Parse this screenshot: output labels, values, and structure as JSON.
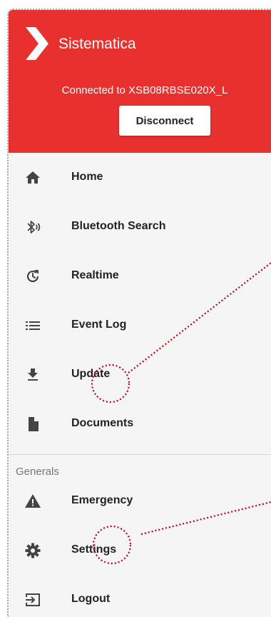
{
  "header": {
    "brand": "Sistematica",
    "connection_text": "Connected to XSB08RBSE020X_L",
    "disconnect_label": "Disconnect",
    "color": "#e8312f"
  },
  "nav": {
    "items": [
      {
        "label": "Home",
        "icon": "home-icon"
      },
      {
        "label": "Bluetooth Search",
        "icon": "bluetooth-searching-icon"
      },
      {
        "label": "Realtime",
        "icon": "history-icon"
      },
      {
        "label": "Event Log",
        "icon": "list-icon"
      },
      {
        "label": "Update",
        "icon": "download-icon"
      },
      {
        "label": "Documents",
        "icon": "document-icon"
      }
    ]
  },
  "generals": {
    "title": "Generals",
    "items": [
      {
        "label": "Emergency",
        "icon": "warning-icon"
      },
      {
        "label": "Settings",
        "icon": "gear-icon"
      },
      {
        "label": "Logout",
        "icon": "logout-icon"
      }
    ]
  }
}
